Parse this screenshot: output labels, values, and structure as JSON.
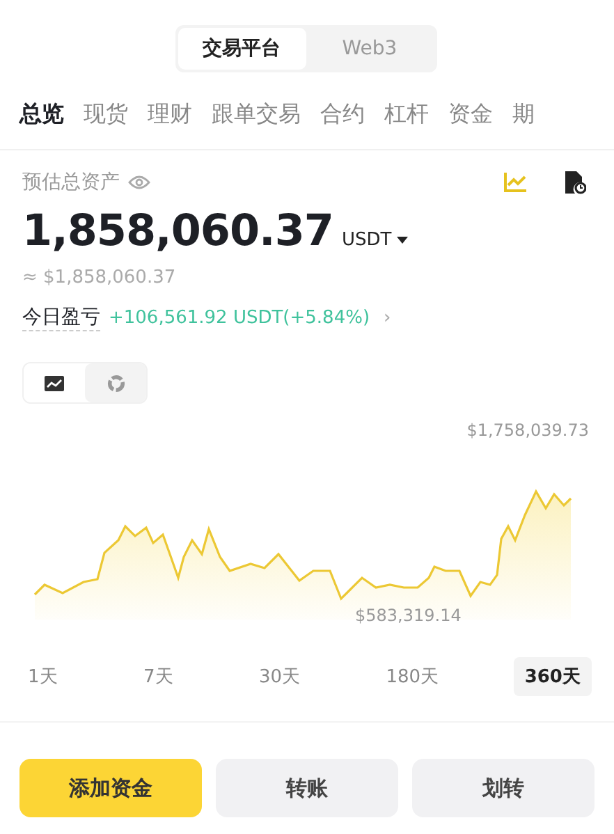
{
  "segments": [
    {
      "label": "交易平台",
      "selected": true
    },
    {
      "label": "Web3",
      "selected": false
    }
  ],
  "tabs": [
    {
      "label": "总览",
      "selected": true
    },
    {
      "label": "现货",
      "selected": false
    },
    {
      "label": "理财",
      "selected": false
    },
    {
      "label": "跟单交易",
      "selected": false
    },
    {
      "label": "合约",
      "selected": false
    },
    {
      "label": "杠杆",
      "selected": false
    },
    {
      "label": "资金",
      "selected": false
    },
    {
      "label": "期",
      "selected": false
    }
  ],
  "balance": {
    "label": "预估总资产",
    "amount": "1,858,060.37",
    "currency": "USDT",
    "approx": "≈ $1,858,060.37"
  },
  "pnl": {
    "label": "今日盈亏",
    "value": "+106,561.92 USDT(+5.84%)",
    "arrow": "›"
  },
  "chart_views": [
    {
      "kind": "line",
      "selected": true
    },
    {
      "kind": "pie",
      "selected": false
    }
  ],
  "chart": {
    "high": "$1,758,039.73",
    "low": "$583,319.14"
  },
  "ranges": [
    {
      "label": "1天",
      "selected": false
    },
    {
      "label": "7天",
      "selected": false
    },
    {
      "label": "30天",
      "selected": false
    },
    {
      "label": "180天",
      "selected": false
    },
    {
      "label": "360天",
      "selected": true
    }
  ],
  "actions": [
    {
      "label": "添加资金",
      "kind": "primary"
    },
    {
      "label": "转账",
      "kind": "secondary"
    },
    {
      "label": "划转",
      "kind": "secondary"
    }
  ]
}
